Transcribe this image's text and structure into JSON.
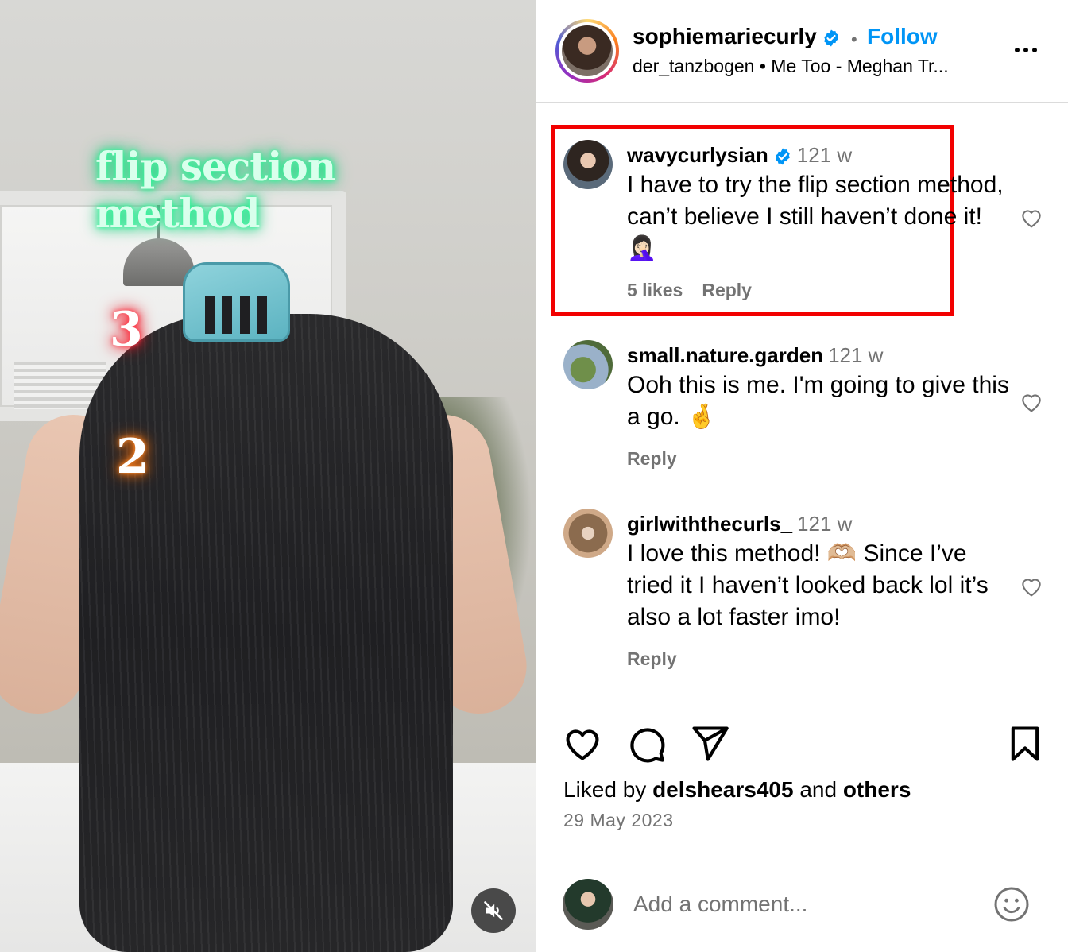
{
  "video": {
    "overlay_title": "flip section method",
    "step_3": "3",
    "step_2": "2",
    "mute_icon": "muted-speaker-icon"
  },
  "header": {
    "username": "sophiemariecurly",
    "verified_icon": "verified-badge-icon",
    "separator": "•",
    "follow_label": "Follow",
    "audio": "der_tanzbogen  •  Me Too - Meghan Tr..."
  },
  "comments": [
    {
      "username": "wavycurlysian",
      "verified": true,
      "time": "121 w",
      "text": "I have to try the flip section method, can’t believe I still haven’t done it! 🤦🏻‍♀️",
      "likes": "5 likes",
      "reply": "Reply"
    },
    {
      "username": "small.nature.garden",
      "verified": false,
      "time": "121 w",
      "text": "Ooh this is me. I'm going to give this a go. 🤞",
      "reply": "Reply"
    },
    {
      "username": "girlwiththecurls_",
      "verified": false,
      "time": "121 w",
      "text": "I love this method! 🫶🏼 Since I’ve tried it I haven’t looked back lol it’s also a lot faster imo!",
      "reply": "Reply"
    }
  ],
  "actions": {
    "like_icon": "heart-icon",
    "comment_icon": "comment-bubble-icon",
    "share_icon": "paper-plane-icon",
    "save_icon": "bookmark-icon"
  },
  "likes": {
    "prefix": "Liked by",
    "user": "delshears405",
    "joiner": "and",
    "others": "others"
  },
  "date": "29 May 2023",
  "composer": {
    "placeholder": "Add a comment...",
    "emoji_icon": "smiley-icon"
  },
  "colors": {
    "follow_blue": "#0095f6",
    "verified_blue": "#0095f6",
    "highlight_red": "#f20000",
    "secondary_text": "#737373"
  }
}
